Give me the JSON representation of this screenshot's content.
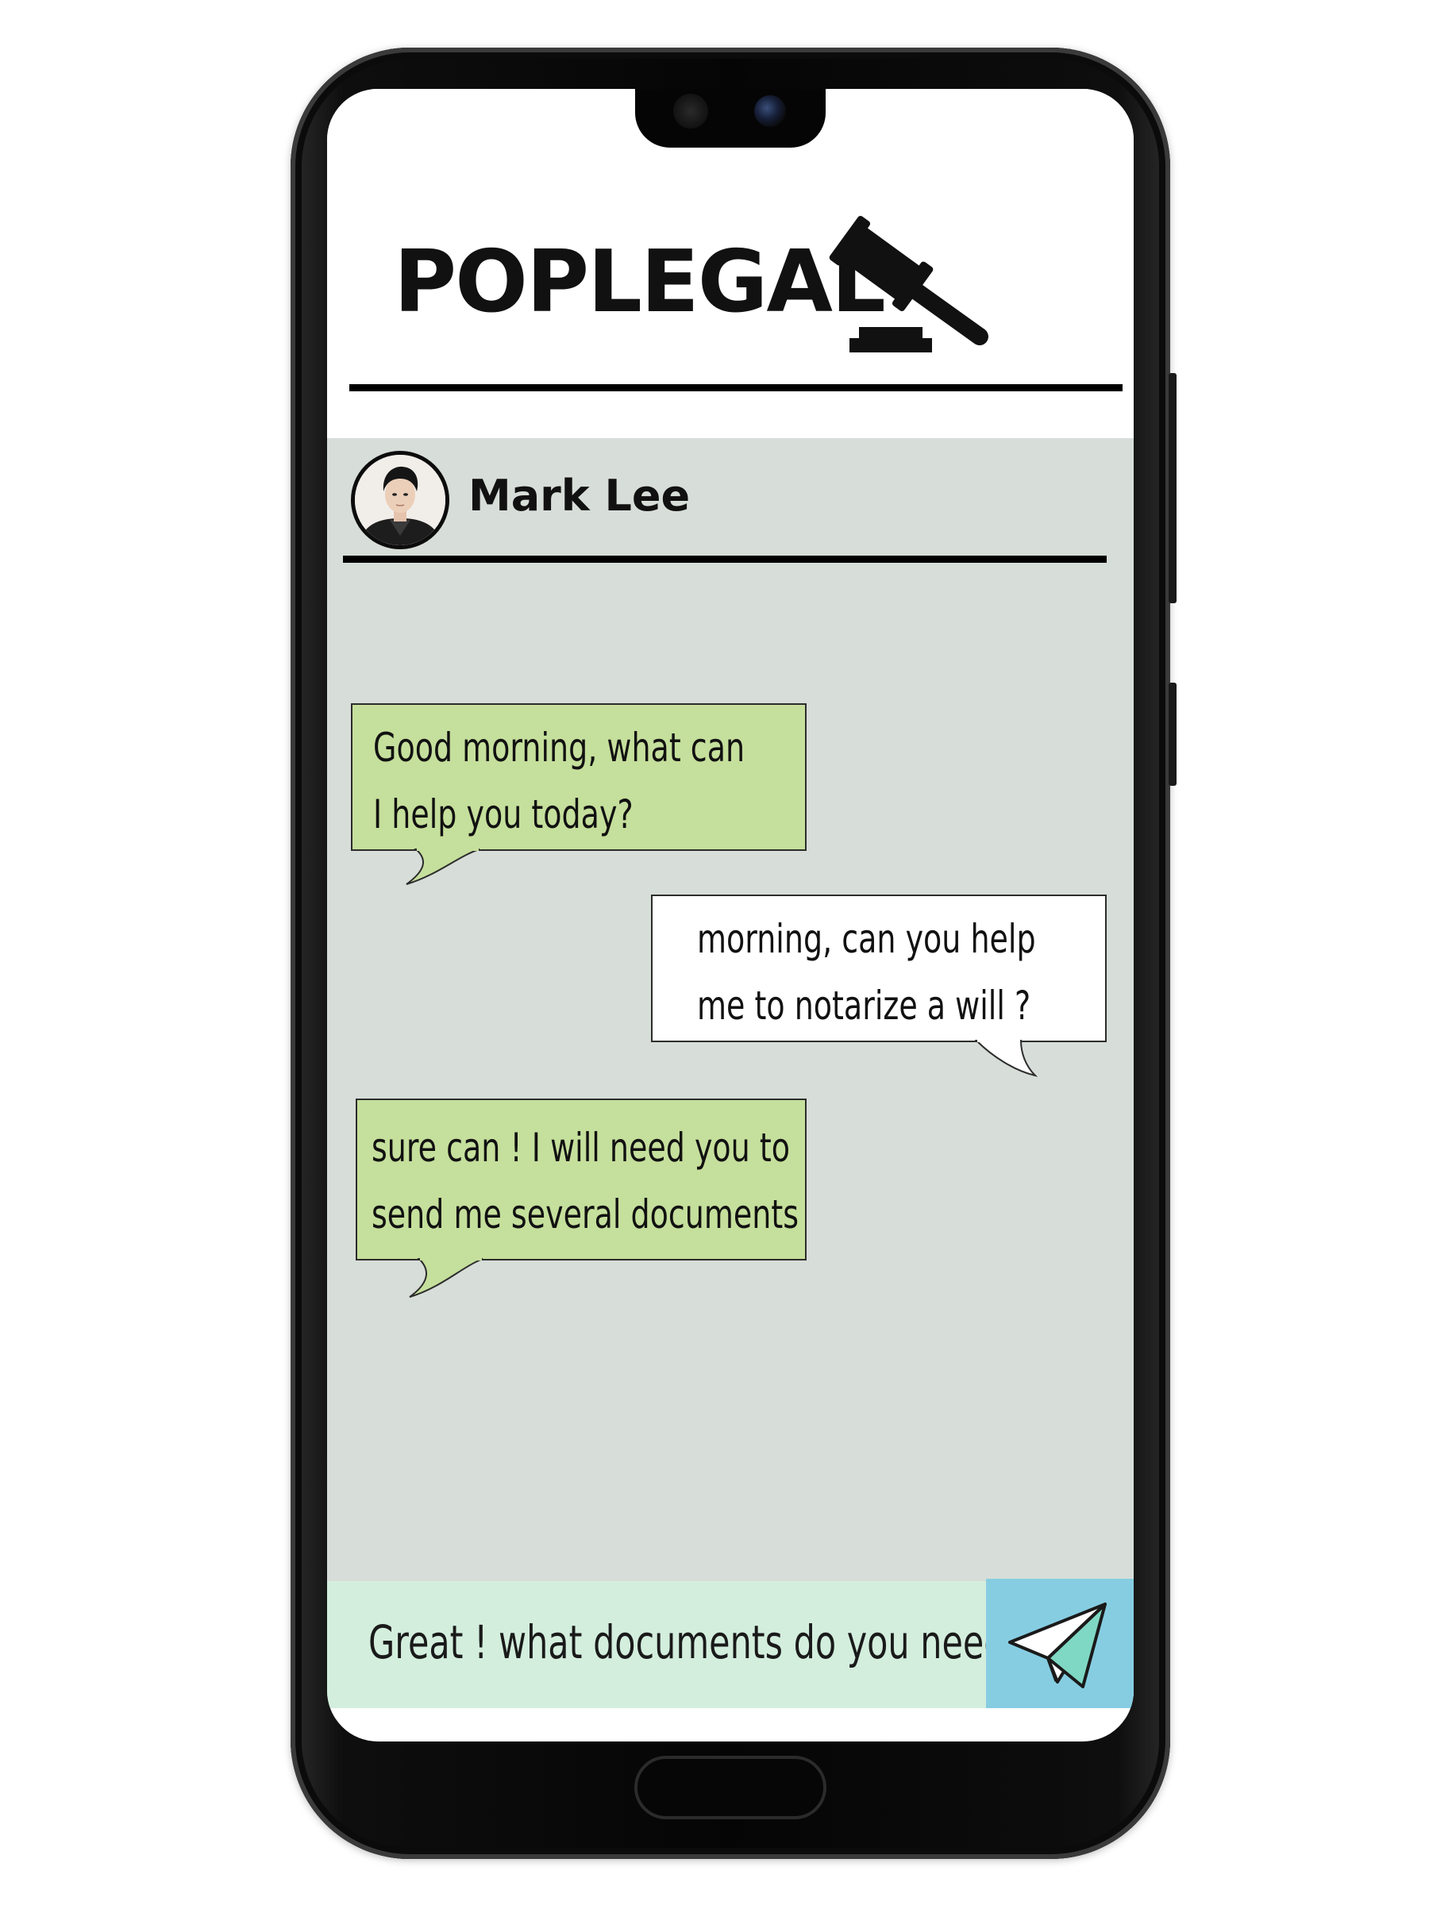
{
  "app": {
    "title": "POPLEGAL",
    "logo_icon": "gavel-icon"
  },
  "contact": {
    "name": "Mark Lee",
    "avatar_icon": "avatar"
  },
  "messages": [
    {
      "direction": "incoming",
      "lines": [
        "Good morning, what can",
        "I help you today?"
      ]
    },
    {
      "direction": "outgoing",
      "lines": [
        "morning, can you help",
        "me to notarize a will ?"
      ]
    },
    {
      "direction": "incoming",
      "lines": [
        "sure can ! I will need you to",
        "send me several documents"
      ]
    }
  ],
  "composer": {
    "value": "Great ! what documents do you need |",
    "send_icon": "paper-plane-icon"
  },
  "colors": {
    "incoming_bubble": "#c5df9c",
    "outgoing_bubble": "#ffffff",
    "chat_background": "#d7ddd8",
    "composer_background": "#d3eedd",
    "send_button": "#86cde2"
  }
}
